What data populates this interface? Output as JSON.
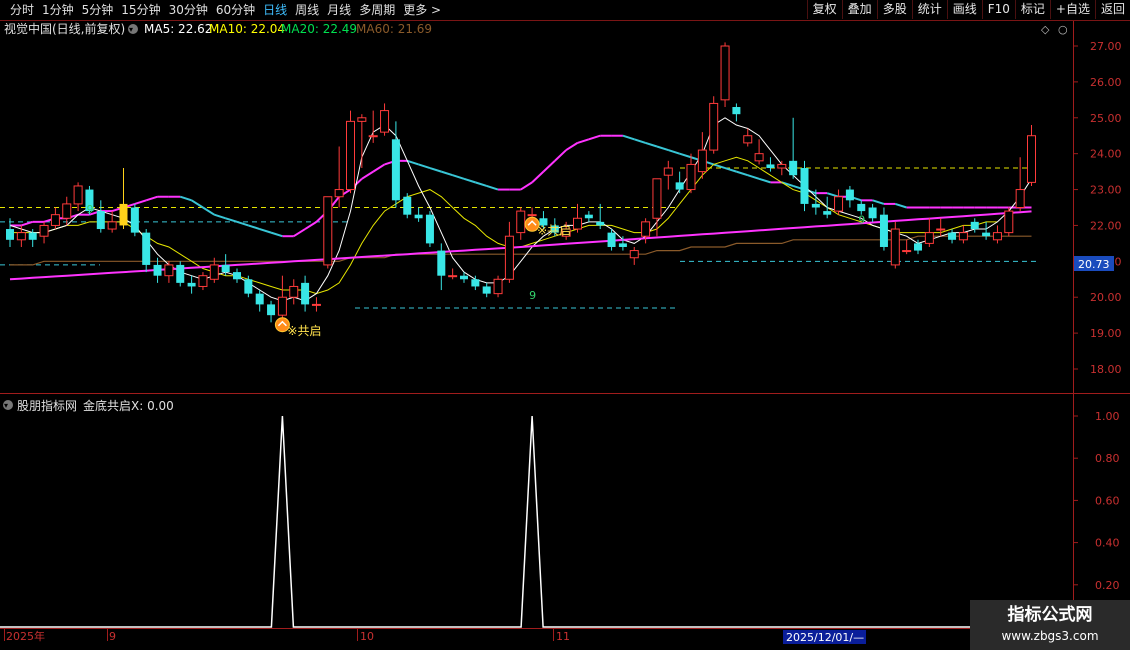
{
  "toolbar": {
    "left": [
      "分时",
      "1分钟",
      "5分钟",
      "15分钟",
      "30分钟",
      "60分钟",
      "日线",
      "周线",
      "月线",
      "多周期",
      "更多 >"
    ],
    "active": "日线",
    "right": [
      "复权",
      "叠加",
      "多股",
      "统计",
      "画线",
      "F10",
      "标记",
      "+自选",
      "返回"
    ]
  },
  "main": {
    "title": "视觉中国(日线,前复权)",
    "ma": [
      {
        "label": "MA5: 22.62",
        "color": "#ffffff"
      },
      {
        "label": "MA10: 22.04",
        "color": "#ffff00"
      },
      {
        "label": "MA20: 22.49",
        "color": "#ff33ff"
      },
      {
        "label": "MA60: 21.69",
        "color": "#8a5a2a"
      }
    ],
    "y_ticks": [
      "27.00",
      "26.00",
      "25.00",
      "24.00",
      "23.00",
      "22.00",
      "21.00",
      "20.00",
      "19.00",
      "18.00"
    ],
    "y_range": [
      17.4,
      27.4
    ],
    "price_box": "20.73",
    "signal_label": "※共启",
    "nine_label": "9"
  },
  "indicator": {
    "title": "股朋指标网",
    "series_label": "金底共启X: 0.00",
    "y_ticks": [
      "1.00",
      "0.80",
      "0.60",
      "0.40",
      "0.20"
    ],
    "spikes_at_candle": [
      24,
      46
    ]
  },
  "x_axis": {
    "labels": [
      "2025年",
      "9",
      "10",
      "11",
      "2025/12/01/—"
    ]
  },
  "watermark": {
    "line1": "指标公式网",
    "line2": "www.zbgs3.com"
  },
  "chart_data": {
    "type": "candlestick",
    "candles": [
      [
        21.9,
        21.6,
        22.2,
        21.4
      ],
      [
        21.6,
        21.8,
        22.0,
        21.4
      ],
      [
        21.8,
        21.6,
        21.9,
        21.4
      ],
      [
        21.7,
        22.0,
        22.1,
        21.5
      ],
      [
        22.0,
        22.3,
        22.5,
        21.9
      ],
      [
        22.2,
        22.6,
        22.8,
        22.0
      ],
      [
        22.6,
        23.1,
        23.2,
        22.4
      ],
      [
        23.0,
        22.4,
        23.1,
        22.3
      ],
      [
        22.4,
        21.9,
        22.7,
        21.8
      ],
      [
        21.9,
        22.1,
        22.4,
        21.8
      ],
      [
        22.0,
        22.6,
        23.6,
        21.9
      ],
      [
        22.5,
        21.8,
        22.6,
        21.7
      ],
      [
        21.8,
        20.9,
        21.9,
        20.7
      ],
      [
        20.9,
        20.6,
        21.1,
        20.4
      ],
      [
        20.6,
        20.9,
        21.0,
        20.4
      ],
      [
        20.9,
        20.4,
        21.0,
        20.3
      ],
      [
        20.4,
        20.3,
        20.6,
        20.1
      ],
      [
        20.3,
        20.6,
        20.7,
        20.2
      ],
      [
        20.5,
        20.9,
        21.1,
        20.4
      ],
      [
        20.9,
        20.7,
        21.2,
        20.6
      ],
      [
        20.7,
        20.5,
        20.8,
        20.4
      ],
      [
        20.5,
        20.1,
        20.6,
        20.0
      ],
      [
        20.1,
        19.8,
        20.2,
        19.6
      ],
      [
        19.8,
        19.5,
        19.9,
        19.3
      ],
      [
        19.5,
        20.0,
        20.6,
        19.4
      ],
      [
        20.0,
        20.3,
        20.5,
        19.8
      ],
      [
        20.4,
        19.8,
        20.6,
        19.6
      ],
      [
        19.8,
        19.8,
        20.0,
        19.6
      ],
      [
        20.9,
        22.8,
        22.8,
        20.8
      ],
      [
        22.8,
        23.0,
        24.2,
        22.5
      ],
      [
        23.0,
        24.9,
        25.2,
        22.9
      ],
      [
        24.9,
        25.0,
        25.1,
        23.6
      ],
      [
        24.5,
        24.5,
        25.2,
        24.3
      ],
      [
        24.6,
        25.2,
        25.4,
        24.5
      ],
      [
        24.4,
        22.7,
        24.9,
        22.5
      ],
      [
        22.8,
        22.3,
        22.9,
        22.2
      ],
      [
        22.3,
        22.2,
        22.5,
        22.1
      ],
      [
        22.3,
        21.5,
        22.4,
        21.4
      ],
      [
        21.3,
        20.6,
        21.5,
        20.2
      ],
      [
        20.6,
        20.6,
        20.8,
        20.5
      ],
      [
        20.6,
        20.5,
        20.7,
        20.4
      ],
      [
        20.5,
        20.3,
        20.6,
        20.2
      ],
      [
        20.3,
        20.1,
        20.4,
        20.0
      ],
      [
        20.1,
        20.5,
        20.6,
        20.0
      ],
      [
        20.5,
        21.7,
        22.1,
        20.4
      ],
      [
        21.8,
        22.4,
        22.5,
        21.6
      ],
      [
        22.3,
        22.3,
        22.5,
        22.2
      ],
      [
        22.2,
        22.0,
        22.4,
        21.9
      ],
      [
        22.0,
        21.8,
        22.2,
        21.7
      ],
      [
        21.7,
        21.9,
        22.1,
        21.6
      ],
      [
        21.9,
        22.2,
        22.6,
        21.8
      ],
      [
        22.3,
        22.2,
        22.4,
        22.1
      ],
      [
        22.1,
        22.0,
        22.6,
        21.9
      ],
      [
        21.8,
        21.4,
        21.9,
        21.3
      ],
      [
        21.5,
        21.4,
        21.7,
        21.3
      ],
      [
        21.1,
        21.3,
        21.4,
        20.9
      ],
      [
        21.7,
        22.1,
        22.2,
        21.5
      ],
      [
        22.2,
        23.3,
        23.3,
        21.7
      ],
      [
        23.4,
        23.6,
        23.8,
        23.0
      ],
      [
        23.2,
        23.0,
        23.5,
        22.9
      ],
      [
        23.0,
        23.7,
        24.0,
        22.9
      ],
      [
        23.5,
        24.1,
        24.6,
        23.3
      ],
      [
        24.1,
        25.4,
        25.6,
        24.0
      ],
      [
        25.5,
        27.0,
        27.1,
        25.3
      ],
      [
        25.3,
        25.1,
        25.4,
        24.9
      ],
      [
        24.3,
        24.5,
        24.7,
        24.2
      ],
      [
        23.8,
        24.0,
        24.4,
        23.7
      ],
      [
        23.7,
        23.6,
        23.9,
        23.5
      ],
      [
        23.6,
        23.7,
        23.8,
        23.4
      ],
      [
        23.8,
        23.4,
        25.0,
        23.3
      ],
      [
        23.6,
        22.6,
        23.8,
        22.4
      ],
      [
        22.6,
        22.5,
        23.0,
        22.3
      ],
      [
        22.4,
        22.3,
        22.8,
        22.2
      ],
      [
        22.4,
        22.8,
        23.0,
        22.3
      ],
      [
        23.0,
        22.7,
        23.1,
        22.5
      ],
      [
        22.6,
        22.4,
        22.7,
        22.3
      ],
      [
        22.5,
        22.2,
        22.6,
        22.1
      ],
      [
        22.3,
        21.4,
        22.5,
        21.3
      ],
      [
        20.9,
        21.9,
        22.1,
        20.8
      ],
      [
        21.3,
        21.3,
        21.6,
        21.2
      ],
      [
        21.5,
        21.3,
        21.6,
        21.2
      ],
      [
        21.5,
        21.8,
        22.2,
        21.4
      ],
      [
        21.9,
        21.9,
        22.2,
        21.7
      ],
      [
        21.8,
        21.6,
        21.9,
        21.5
      ],
      [
        21.6,
        21.8,
        22.0,
        21.5
      ],
      [
        22.1,
        21.9,
        22.2,
        21.8
      ],
      [
        21.8,
        21.7,
        22.1,
        21.6
      ],
      [
        21.6,
        21.8,
        22.0,
        21.5
      ],
      [
        21.8,
        22.4,
        22.5,
        21.7
      ],
      [
        22.5,
        23.0,
        23.9,
        22.4
      ],
      [
        23.2,
        24.5,
        24.8,
        23.1
      ]
    ],
    "ma5": [
      22.0,
      21.9,
      21.8,
      21.8,
      21.9,
      22.0,
      22.3,
      22.5,
      22.4,
      22.3,
      22.2,
      22.0,
      21.6,
      21.2,
      20.9,
      20.7,
      20.6,
      20.5,
      20.6,
      20.7,
      20.6,
      20.4,
      20.2,
      20.0,
      19.9,
      20.0,
      19.9,
      20.1,
      20.6,
      21.3,
      22.4,
      23.9,
      24.6,
      24.8,
      24.5,
      23.8,
      23.1,
      22.5,
      21.8,
      21.1,
      20.7,
      20.5,
      20.4,
      20.4,
      20.6,
      21.0,
      21.4,
      21.7,
      21.9,
      22.0,
      22.0,
      22.1,
      22.1,
      21.9,
      21.6,
      21.5,
      21.7,
      22.1,
      22.5,
      23.0,
      23.5,
      24.0,
      24.8,
      25.0,
      24.8,
      24.7,
      24.5,
      24.1,
      23.7,
      23.4,
      23.1,
      22.8,
      22.5,
      22.4,
      22.3,
      22.2,
      22.0,
      21.9,
      21.8,
      21.7,
      21.5,
      21.6,
      21.7,
      21.8,
      21.8,
      21.9,
      21.9,
      22.1,
      22.4,
      22.8,
      23.3
    ],
    "ma10": [
      21.8,
      21.8,
      21.8,
      21.8,
      21.9,
      22.0,
      22.0,
      22.1,
      22.1,
      22.1,
      22.1,
      21.9,
      21.7,
      21.5,
      21.4,
      21.2,
      21.0,
      20.8,
      20.7,
      20.6,
      20.6,
      20.5,
      20.4,
      20.3,
      20.2,
      20.2,
      20.2,
      20.1,
      20.2,
      20.4,
      20.9,
      21.5,
      22.0,
      22.4,
      22.6,
      22.8,
      22.9,
      23.0,
      22.8,
      22.5,
      22.2,
      22.0,
      21.7,
      21.5,
      21.4,
      21.4,
      21.5,
      21.6,
      21.7,
      21.8,
      21.9,
      22.0,
      22.0,
      22.0,
      21.9,
      21.8,
      21.8,
      21.9,
      22.2,
      22.6,
      23.0,
      23.4,
      23.7,
      23.8,
      23.9,
      23.8,
      23.6,
      23.4,
      23.2,
      23.0,
      22.9,
      22.7,
      22.5,
      22.3,
      22.2,
      22.1,
      22.0,
      21.9,
      21.8,
      21.8,
      21.8,
      21.8,
      21.8,
      21.9,
      22.0,
      22.0,
      22.1,
      22.1
    ],
    "ma20": [
      22.0,
      22.0,
      22.1,
      22.1,
      22.2,
      22.2,
      22.3,
      22.3,
      22.4,
      22.4,
      22.5,
      22.6,
      22.7,
      22.8,
      22.8,
      22.8,
      22.7,
      22.5,
      22.3,
      22.2,
      22.1,
      22.0,
      21.9,
      21.8,
      21.7,
      21.7,
      21.9,
      22.1,
      22.4,
      22.8,
      23.0,
      23.3,
      23.5,
      23.7,
      23.8,
      23.8,
      23.7,
      23.6,
      23.5,
      23.4,
      23.3,
      23.2,
      23.1,
      23.0,
      23.0,
      23.0,
      23.2,
      23.5,
      23.8,
      24.1,
      24.3,
      24.4,
      24.5,
      24.5,
      24.5,
      24.4,
      24.3,
      24.2,
      24.1,
      24.0,
      23.9,
      23.8,
      23.7,
      23.6,
      23.5,
      23.4,
      23.3,
      23.2,
      23.2,
      23.1,
      23.0,
      22.9,
      22.9,
      22.8,
      22.8,
      22.7,
      22.7,
      22.6,
      22.6,
      22.5,
      22.5,
      22.5,
      22.5,
      22.5,
      22.5,
      22.5,
      22.5,
      22.5,
      22.5,
      22.5,
      22.5
    ],
    "ma60": [
      20.9,
      20.9,
      20.9,
      21.0,
      21.0,
      21.0,
      21.0,
      21.0,
      21.0,
      21.0,
      21.0,
      21.0,
      21.0,
      21.0,
      21.0,
      21.0,
      21.0,
      21.0,
      21.0,
      21.0,
      21.0,
      21.0,
      21.0,
      21.0,
      21.0,
      21.0,
      21.0,
      21.0,
      21.0,
      21.0,
      21.1,
      21.1,
      21.1,
      21.1,
      21.2,
      21.2,
      21.2,
      21.2,
      21.2,
      21.2,
      21.2,
      21.2,
      21.2,
      21.2,
      21.2,
      21.2,
      21.2,
      21.2,
      21.2,
      21.2,
      21.2,
      21.2,
      21.2,
      21.2,
      21.2,
      21.2,
      21.2,
      21.3,
      21.3,
      21.3,
      21.4,
      21.4,
      21.4,
      21.4,
      21.5,
      21.5,
      21.5,
      21.5,
      21.5,
      21.6,
      21.6,
      21.6,
      21.6,
      21.6,
      21.6,
      21.6,
      21.6,
      21.6,
      21.6,
      21.6,
      21.7,
      21.7,
      21.7,
      21.7,
      21.7,
      21.7,
      21.7,
      21.7,
      21.7,
      21.7,
      21.7
    ],
    "hlines": [
      {
        "y": 22.5,
        "color": "#e6e600",
        "x0": 0,
        "x1": 350
      },
      {
        "y": 22.1,
        "color": "#39c6d6",
        "x0": 0,
        "x1": 350
      },
      {
        "y": 20.9,
        "color": "#39c6d6",
        "x0": 0,
        "x1": 100
      },
      {
        "y": 19.7,
        "color": "#39c6d6",
        "x0": 355,
        "x1": 675
      },
      {
        "y": 22.5,
        "color": "#e6e600",
        "x0": 355,
        "x1": 675
      },
      {
        "y": 23.6,
        "color": "#e6e600",
        "x0": 680,
        "x1": 1040
      },
      {
        "y": 21.0,
        "color": "#39c6d6",
        "x0": 680,
        "x1": 1040
      }
    ],
    "yellow_candle": 10
  }
}
